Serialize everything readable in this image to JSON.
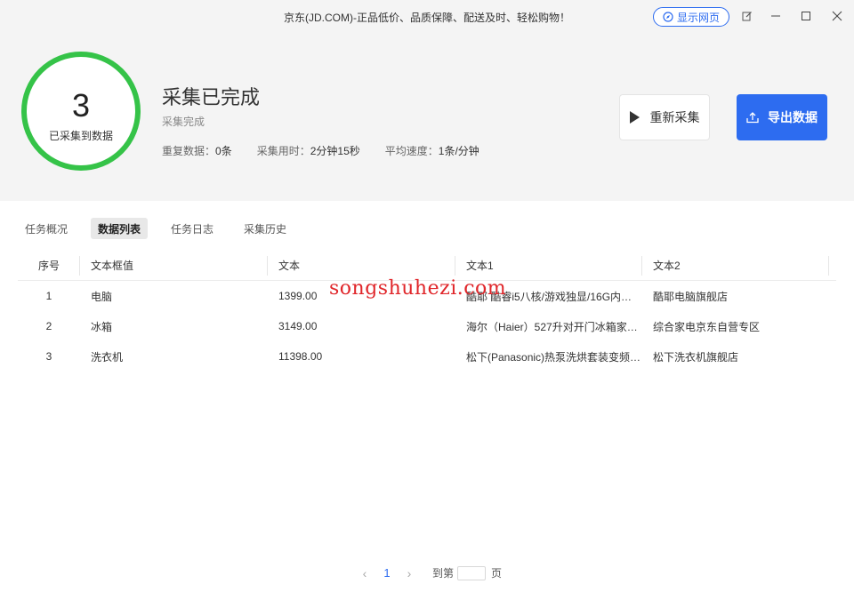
{
  "window": {
    "title": "京东(JD.COM)-正品低价、品质保障、配送及时、轻松购物！",
    "show_web_label": "显示网页"
  },
  "summary": {
    "count": "3",
    "count_label": "已采集到数据",
    "status_title": "采集已完成",
    "status_sub": "采集完成",
    "stats": {
      "dup_label": "重复数据：",
      "dup_value": "0条",
      "time_label": "采集用时：",
      "time_value": "2分钟15秒",
      "speed_label": "平均速度：",
      "speed_value": "1条/分钟"
    },
    "recollect_label": "重新采集",
    "export_label": "导出数据",
    "ring_color": "#35c348",
    "accent_color": "#2d6cf0"
  },
  "tabs": [
    {
      "label": "任务概况"
    },
    {
      "label": "数据列表"
    },
    {
      "label": "任务日志"
    },
    {
      "label": "采集历史"
    }
  ],
  "table": {
    "columns": [
      "序号",
      "文本框值",
      "文本",
      "文本1",
      "文本2"
    ],
    "rows": [
      [
        "1",
        "电脑",
        "1399.00",
        "酷耶 酷睿i5八核/游戏独显/16G内…",
        "酷耶电脑旗舰店"
      ],
      [
        "2",
        "冰箱",
        "3149.00",
        "海尔（Haier）527升对开门冰箱家…",
        "综合家电京东自营专区"
      ],
      [
        "3",
        "洗衣机",
        "11398.00",
        "松下(Panasonic)热泵洗烘套装变频…",
        "松下洗衣机旗舰店"
      ]
    ]
  },
  "watermark": "songshuhezi.com",
  "pager": {
    "prev_icon": "chevron-left-icon",
    "next_icon": "chevron-right-icon",
    "current_page": "1",
    "goto_label": "到第",
    "page_unit": "页"
  }
}
